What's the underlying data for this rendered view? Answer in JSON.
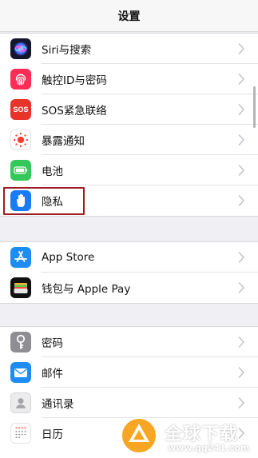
{
  "nav": {
    "title": "设置"
  },
  "groups": [
    {
      "items": [
        {
          "label": "Siri与搜索",
          "icon": "siri-icon"
        },
        {
          "label": "触控ID与密码",
          "icon": "fingerprint-icon"
        },
        {
          "label": "SOS紧急联络",
          "icon": "sos-icon",
          "icon_text": "SOS"
        },
        {
          "label": "暴露通知",
          "icon": "exposure-notification-icon"
        },
        {
          "label": "电池",
          "icon": "battery-icon"
        },
        {
          "label": "隐私",
          "icon": "privacy-hand-icon"
        }
      ]
    },
    {
      "items": [
        {
          "label": "App Store",
          "icon": "app-store-icon"
        },
        {
          "label": "钱包与 Apple Pay",
          "icon": "wallet-icon"
        }
      ]
    },
    {
      "items": [
        {
          "label": "密码",
          "icon": "key-icon"
        },
        {
          "label": "邮件",
          "icon": "mail-icon"
        },
        {
          "label": "通讯录",
          "icon": "contacts-icon"
        },
        {
          "label": "日历",
          "icon": "calendar-icon"
        }
      ]
    }
  ],
  "watermark": {
    "title": "全球下载",
    "url": "www.qq241.com"
  },
  "colors": {
    "siri": "#2a2a6e",
    "touch_id": "#ff2d55",
    "sos": "#e8332a",
    "exposure": "#ff3b30",
    "battery": "#34c759",
    "privacy": "#1a7cf5",
    "app_store": "#1e8cf5",
    "wallet": "#111111",
    "passwords": "#8e8e93",
    "mail": "#1e8cf5",
    "highlight_border": "#9e1b22"
  }
}
